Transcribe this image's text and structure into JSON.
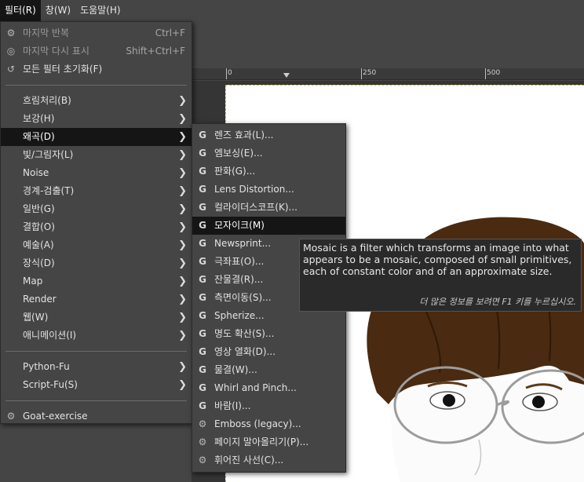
{
  "menubar": {
    "items": [
      {
        "label": "필터(R)",
        "active": true
      },
      {
        "label": "창(W)",
        "active": false
      },
      {
        "label": "도움말(H)",
        "active": false
      }
    ]
  },
  "ruler": {
    "labels": [
      "0",
      "250",
      "500"
    ]
  },
  "filters_menu": {
    "repeat_last": {
      "label": "마지막 반복",
      "shortcut": "Ctrl+F",
      "icon": "repeat-icon"
    },
    "reshow_last": {
      "label": "마지막 다시 표시",
      "shortcut": "Shift+Ctrl+F",
      "icon": "reshow-icon"
    },
    "reset_all": {
      "label": "모든 필터 초기화(F)",
      "icon": "reset-icon"
    },
    "submenus": [
      {
        "label": "흐림처리(B)"
      },
      {
        "label": "보강(H)"
      },
      {
        "label": "왜곡(D)",
        "active": true
      },
      {
        "label": "빛/그림자(L)"
      },
      {
        "label": "Noise"
      },
      {
        "label": "경계-검출(T)"
      },
      {
        "label": "일반(G)"
      },
      {
        "label": "결합(O)"
      },
      {
        "label": "예술(A)"
      },
      {
        "label": "장식(D)"
      },
      {
        "label": "Map"
      },
      {
        "label": "Render"
      },
      {
        "label": "웹(W)"
      },
      {
        "label": "애니메이션(I)"
      }
    ],
    "script_menus": [
      {
        "label": "Python-Fu"
      },
      {
        "label": "Script-Fu(S)"
      }
    ],
    "goat": {
      "label": "Goat-exercise",
      "icon": "gear-icon"
    }
  },
  "distort_menu": {
    "items": [
      {
        "label": "렌즈 효과(L)...",
        "icon": "gegl-icon"
      },
      {
        "label": "엠보싱(E)...",
        "icon": "gegl-icon"
      },
      {
        "label": "판화(G)...",
        "icon": "gegl-icon"
      },
      {
        "label": "Lens Distortion...",
        "icon": "gegl-icon"
      },
      {
        "label": "컬라이더스코프(K)...",
        "icon": "gegl-icon"
      },
      {
        "label": "모자이크(M)",
        "icon": "gegl-icon",
        "active": true
      },
      {
        "label": "Newsprint...",
        "icon": "gegl-icon"
      },
      {
        "label": "극좌표(O)...",
        "icon": "gegl-icon"
      },
      {
        "label": "잔물결(R)...",
        "icon": "gegl-icon"
      },
      {
        "label": "측면이동(S)...",
        "icon": "gegl-icon"
      },
      {
        "label": "Spherize...",
        "icon": "gegl-icon"
      },
      {
        "label": "명도 확산(S)...",
        "icon": "gegl-icon"
      },
      {
        "label": "영상 열화(D)...",
        "icon": "gegl-icon"
      },
      {
        "label": "물결(W)...",
        "icon": "gegl-icon"
      },
      {
        "label": "Whirl and Pinch...",
        "icon": "gegl-icon"
      },
      {
        "label": "바람(I)...",
        "icon": "gegl-icon"
      },
      {
        "label": "Emboss (legacy)...",
        "icon": "gear-icon"
      },
      {
        "label": "페이지 말아올리기(P)...",
        "icon": "gear-icon"
      },
      {
        "label": "휘어진 사선(C)...",
        "icon": "gear-icon"
      }
    ]
  },
  "tooltip": {
    "text": "Mosaic is a filter which transforms an image into what appears to be a mosaic, composed of small primitives, each of constant color and of an approximate size.",
    "help": "더 많은 정보를 보려면 F1 키를 누르십시오."
  },
  "colors": {
    "menu_bg": "#454545",
    "active_bg": "#151515",
    "tooltip_bg": "#2a2a2a",
    "hair": "#4a2a10"
  }
}
